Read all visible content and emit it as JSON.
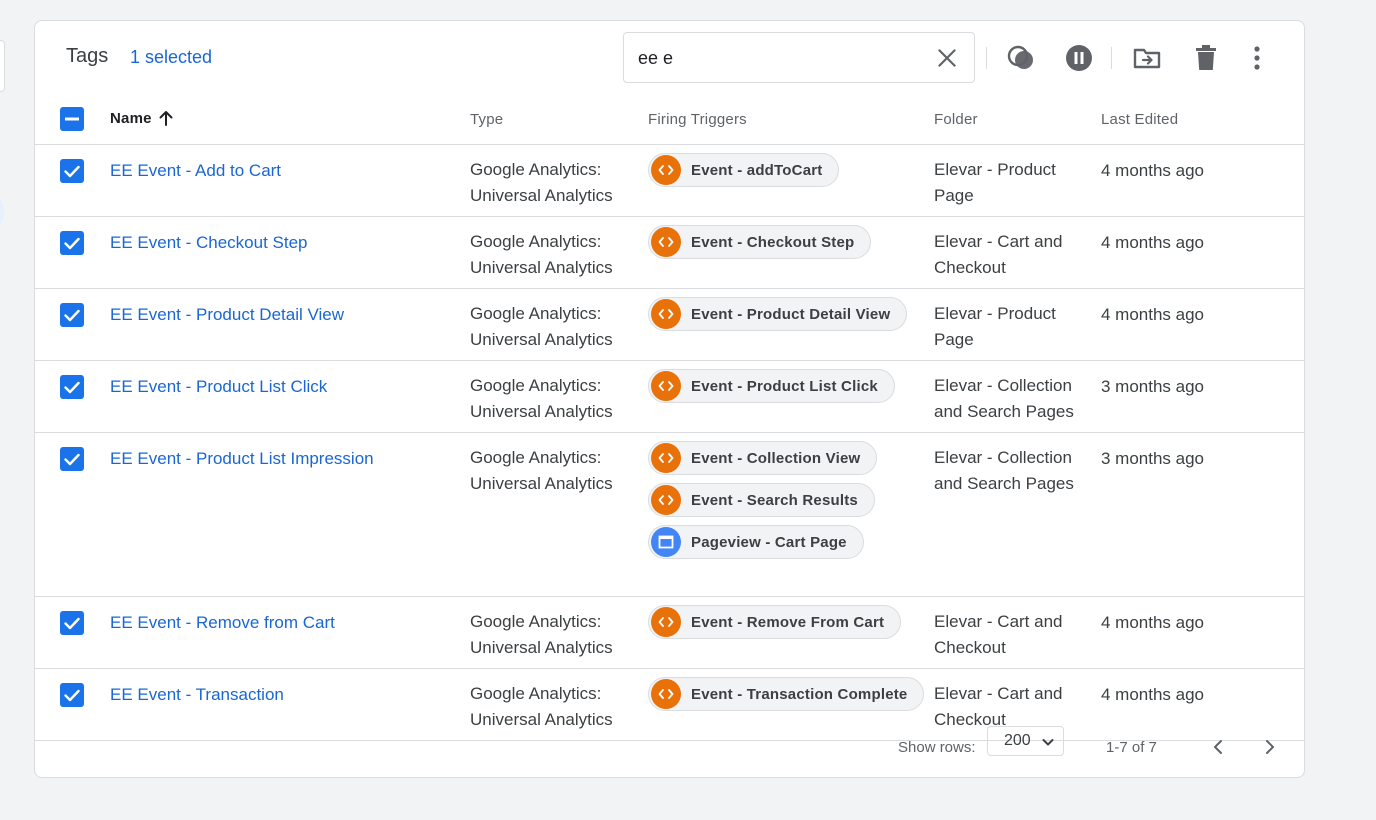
{
  "header": {
    "title": "Tags",
    "selected_label": "1 selected",
    "search_value": "ee e"
  },
  "toolbar": {
    "icons": [
      "merge-icon",
      "pause-icon",
      "move-to-folder-icon",
      "delete-icon",
      "more-vert-icon"
    ]
  },
  "columns": {
    "name": "Name",
    "type": "Type",
    "firing_triggers": "Firing Triggers",
    "folder": "Folder",
    "last_edited": "Last Edited"
  },
  "rows": [
    {
      "name": "EE Event - Add to Cart",
      "type_line1": "Google Analytics:",
      "type_line2": "Universal Analytics",
      "triggers": [
        {
          "label": "Event - addToCart",
          "kind": "event"
        }
      ],
      "folder_line1": "Elevar - Product",
      "folder_line2": "Page",
      "edited": "4 months ago"
    },
    {
      "name": "EE Event - Checkout Step",
      "type_line1": "Google Analytics:",
      "type_line2": "Universal Analytics",
      "triggers": [
        {
          "label": "Event - Checkout Step",
          "kind": "event"
        }
      ],
      "folder_line1": "Elevar - Cart and",
      "folder_line2": "Checkout",
      "edited": "4 months ago"
    },
    {
      "name": "EE Event - Product Detail View",
      "type_line1": "Google Analytics:",
      "type_line2": "Universal Analytics",
      "triggers": [
        {
          "label": "Event - Product Detail View",
          "kind": "event"
        }
      ],
      "folder_line1": "Elevar - Product",
      "folder_line2": "Page",
      "edited": "4 months ago"
    },
    {
      "name": "EE Event - Product List Click",
      "type_line1": "Google Analytics:",
      "type_line2": "Universal Analytics",
      "triggers": [
        {
          "label": "Event - Product List Click",
          "kind": "event"
        }
      ],
      "folder_line1": "Elevar - Collection",
      "folder_line2": "and Search Pages",
      "edited": "3 months ago"
    },
    {
      "name": "EE Event - Product List Impression",
      "type_line1": "Google Analytics:",
      "type_line2": "Universal Analytics",
      "triggers": [
        {
          "label": "Event - Collection View",
          "kind": "event"
        },
        {
          "label": "Event - Search Results",
          "kind": "event"
        },
        {
          "label": "Pageview - Cart Page",
          "kind": "pageview"
        }
      ],
      "folder_line1": "Elevar - Collection",
      "folder_line2": "and Search Pages",
      "edited": "3 months ago"
    },
    {
      "name": "EE Event - Remove from Cart",
      "type_line1": "Google Analytics:",
      "type_line2": "Universal Analytics",
      "triggers": [
        {
          "label": "Event - Remove From Cart",
          "kind": "event"
        }
      ],
      "folder_line1": "Elevar - Cart and",
      "folder_line2": "Checkout",
      "edited": "4 months ago"
    },
    {
      "name": "EE Event - Transaction",
      "type_line1": "Google Analytics:",
      "type_line2": "Universal Analytics",
      "triggers": [
        {
          "label": "Event - Transaction Complete",
          "kind": "event"
        }
      ],
      "folder_line1": "Elevar - Cart and",
      "folder_line2": "Checkout",
      "edited": "4 months ago"
    }
  ],
  "footer": {
    "show_rows_label": "Show rows:",
    "rows_value": "200",
    "page_info": "1-7 of 7"
  },
  "colors": {
    "accent": "#1a73e8",
    "link": "#1967d2",
    "event_trigger": "#e8710a",
    "pageview_trigger": "#4285f4"
  }
}
